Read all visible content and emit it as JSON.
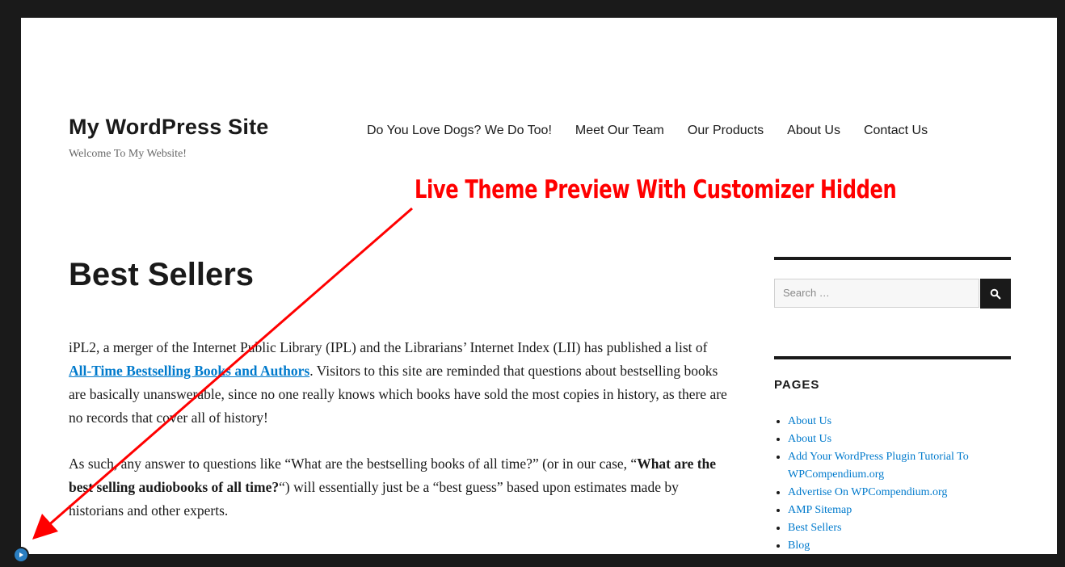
{
  "site": {
    "title": "My WordPress Site",
    "description": "Welcome To My Website!"
  },
  "nav": {
    "items": [
      {
        "label": "Do You Love Dogs? We Do Too!"
      },
      {
        "label": "Meet Our Team"
      },
      {
        "label": "Our Products"
      },
      {
        "label": "About Us"
      },
      {
        "label": "Contact Us"
      }
    ]
  },
  "annotation": {
    "text": "Live Theme Preview With Customizer Hidden",
    "color": "#ff0000"
  },
  "page": {
    "title": "Best Sellers",
    "p1_before": "iPL2, a merger of the Internet Public Library (IPL) and the Librarians’ Internet Index (LII) has published a list of ",
    "p1_link": "All-Time Bestselling Books and Authors",
    "p1_after": ". Visitors to this site are reminded that questions about bestselling books are basically unanswerable, since no one really knows which books have sold the most copies in history, as there are no records that cover all of history!",
    "p2_before": "As such, any answer to questions like “What are the bestselling books of all time?” (or in our case, “",
    "p2_bold": "What are the best selling audiobooks of all time?",
    "p2_after": "“) will essentially just be a “best guess” based upon estimates made by historians and other experts."
  },
  "sidebar": {
    "search_placeholder": "Search …",
    "search_icon": "search-icon",
    "pages_title": "PAGES",
    "pages": [
      {
        "label": "About Us"
      },
      {
        "label": "About Us"
      },
      {
        "label": "Add Your WordPress Plugin Tutorial To",
        "label2": "WPCompendium.org"
      },
      {
        "label": "Advertise On WPCompendium.org"
      },
      {
        "label": "AMP Sitemap"
      },
      {
        "label": "Best Sellers"
      },
      {
        "label": "Blog"
      }
    ]
  },
  "controls": {
    "toggle_icon": "play-circle-icon",
    "accent": "#2a7ec1",
    "link_color": "#007acc"
  }
}
